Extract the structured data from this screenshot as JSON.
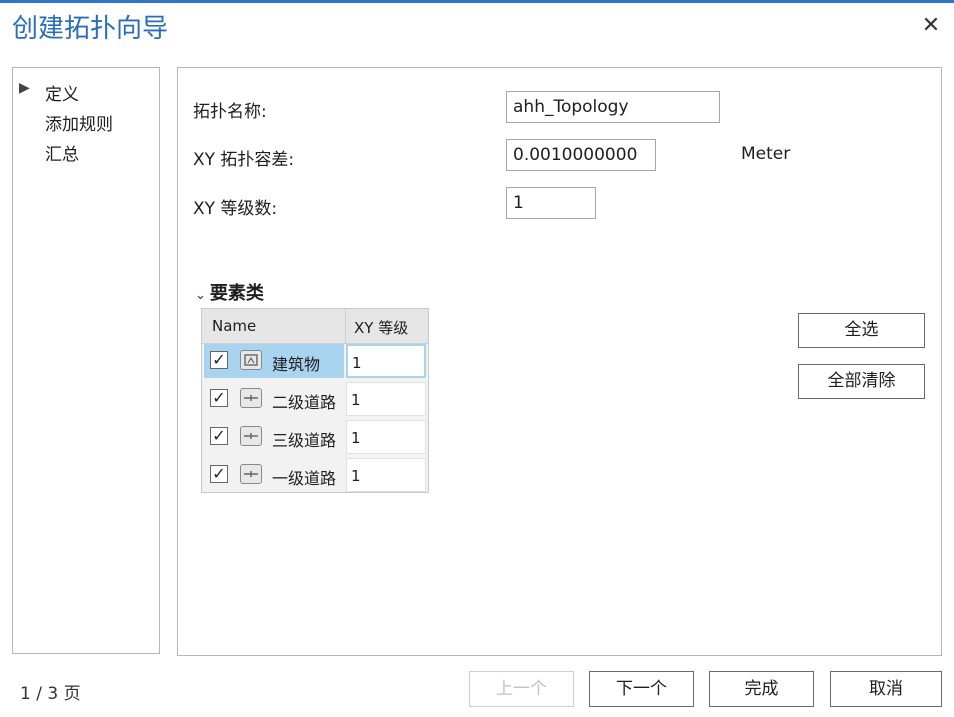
{
  "dialog": {
    "title": "创建拓扑向导",
    "close_icon": "close-icon"
  },
  "steps": [
    {
      "label": "定义",
      "active": true
    },
    {
      "label": "添加规则",
      "active": false
    },
    {
      "label": "汇总",
      "active": false
    }
  ],
  "form": {
    "topology_name_label": "拓扑名称:",
    "topology_name_value": "ahh_Topology",
    "xy_tolerance_label": "XY 拓扑容差:",
    "xy_tolerance_value": "0.0010000000",
    "xy_tolerance_unit": "Meter",
    "xy_rank_count_label": "XY 等级数:",
    "xy_rank_count_value": "1"
  },
  "feature_classes": {
    "section_label": "要素类",
    "columns": [
      "Name",
      "XY 等级"
    ],
    "rows": [
      {
        "checked": true,
        "icon": "polygon-layer-icon",
        "name": "建筑物",
        "rank": "1",
        "selected": true
      },
      {
        "checked": true,
        "icon": "polyline-layer-icon",
        "name": "二级道路",
        "rank": "1",
        "selected": false
      },
      {
        "checked": true,
        "icon": "polyline-layer-icon",
        "name": "三级道路",
        "rank": "1",
        "selected": false
      },
      {
        "checked": true,
        "icon": "polyline-layer-icon",
        "name": "一级道路",
        "rank": "1",
        "selected": false
      }
    ],
    "select_all_label": "全选",
    "clear_all_label": "全部清除"
  },
  "footer": {
    "page_info": "1 / 3 页",
    "prev_label": "上一个",
    "next_label": "下一个",
    "finish_label": "完成",
    "cancel_label": "取消"
  },
  "colors": {
    "title": "#2a6ebb",
    "selection": "#a8d4f0"
  }
}
